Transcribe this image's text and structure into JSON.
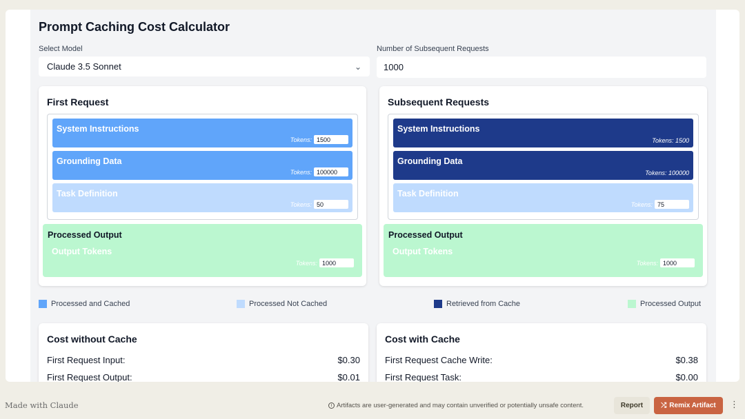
{
  "app": {
    "title": "Prompt Caching Cost Calculator"
  },
  "model": {
    "label": "Select Model",
    "value": "Claude 3.5 Sonnet"
  },
  "requests": {
    "label": "Number of Subsequent Requests",
    "value": "1000"
  },
  "first_request": {
    "title": "First Request",
    "system": {
      "label": "System Instructions",
      "tokens_label": "Tokens:",
      "tokens": "1500"
    },
    "grounding": {
      "label": "Grounding Data",
      "tokens_label": "Tokens:",
      "tokens": "100000"
    },
    "task": {
      "label": "Task Definition",
      "tokens_label": "Tokens:",
      "tokens": "50"
    },
    "output": {
      "title": "Processed Output",
      "sub": "Output Tokens",
      "tokens_label": "Tokens:",
      "tokens": "1000"
    }
  },
  "subsequent": {
    "title": "Subsequent Requests",
    "system": {
      "label": "System Instructions",
      "tokens_text": "Tokens: 1500"
    },
    "grounding": {
      "label": "Grounding Data",
      "tokens_text": "Tokens: 100000"
    },
    "task": {
      "label": "Task Definition",
      "tokens_label": "Tokens:",
      "tokens": "75"
    },
    "output": {
      "title": "Processed Output",
      "sub": "Output Tokens",
      "tokens_label": "Tokens:",
      "tokens": "1000"
    }
  },
  "legend": [
    {
      "label": "Processed and Cached",
      "color": "#60a5fa"
    },
    {
      "label": "Processed Not Cached",
      "color": "#bfdbfe"
    },
    {
      "label": "Retrieved from Cache",
      "color": "#1e3a8a"
    },
    {
      "label": "Processed Output",
      "color": "#bbf7d0"
    }
  ],
  "cost_without": {
    "title": "Cost without Cache",
    "rows": [
      {
        "label": "First Request Input:",
        "value": "$0.30"
      },
      {
        "label": "First Request Output:",
        "value": "$0.01"
      }
    ]
  },
  "cost_with": {
    "title": "Cost with Cache",
    "rows": [
      {
        "label": "First Request Cache Write:",
        "value": "$0.38"
      },
      {
        "label": "First Request Task:",
        "value": "$0.00"
      }
    ]
  },
  "footer": {
    "made_with": "Made with Claude",
    "notice": "Artifacts are user-generated and may contain unverified or potentially unsafe content.",
    "report": "Report",
    "remix": "Remix Artifact",
    "more": "⋮"
  },
  "icons": {
    "chevron": "chevron-down-icon",
    "info": "info-icon",
    "shuffle": "shuffle-icon",
    "more": "more-vertical-icon"
  }
}
